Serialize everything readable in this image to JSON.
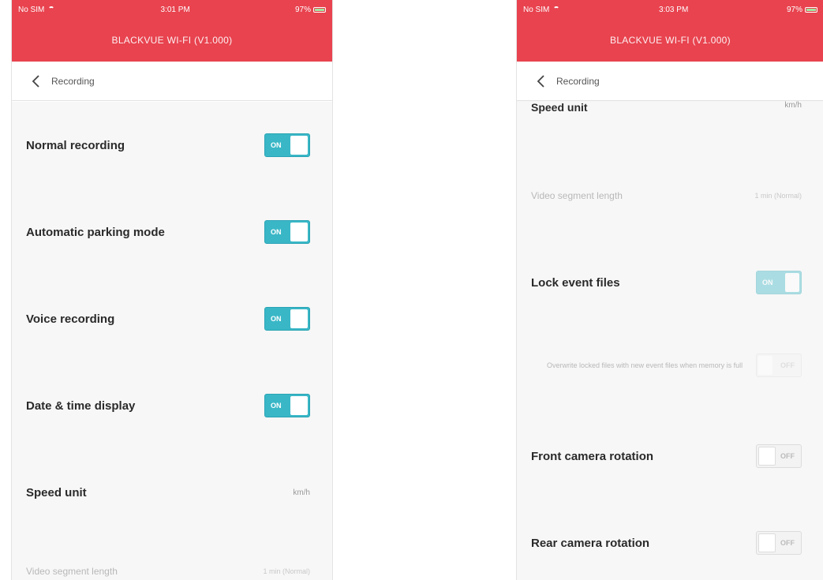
{
  "left": {
    "status": {
      "carrier": "No SIM",
      "time": "3:01 PM",
      "battery": "97%"
    },
    "app_title": "BLACKVUE WI-FI (V1.000)",
    "nav": {
      "title": "Recording"
    },
    "rows": [
      {
        "label": "Normal recording",
        "toggle": "ON"
      },
      {
        "label": "Automatic parking mode",
        "toggle": "ON"
      },
      {
        "label": "Voice recording",
        "toggle": "ON"
      },
      {
        "label": "Date & time display",
        "toggle": "ON"
      },
      {
        "label": "Speed unit",
        "value": "km/h"
      },
      {
        "label": "Video segment length",
        "value": "1 min (Normal)"
      }
    ]
  },
  "right": {
    "status": {
      "carrier": "No SIM",
      "time": "3:03 PM",
      "battery": "97%"
    },
    "app_title": "BLACKVUE WI-FI (V1.000)",
    "nav": {
      "title": "Recording"
    },
    "rows": [
      {
        "label": "Speed unit",
        "value": "km/h"
      },
      {
        "label": "Video segment length",
        "value": "1 min (Normal)"
      },
      {
        "label": "Lock event files",
        "toggle": "ON"
      },
      {
        "label": "Overwrite locked files with new event files when memory is full",
        "toggle": "OFF"
      },
      {
        "label": "Front camera rotation",
        "toggle": "OFF"
      },
      {
        "label": "Rear camera rotation",
        "toggle": "OFF"
      }
    ]
  },
  "colors": {
    "header": "#e8434f",
    "toggle_on": "#39b7c7",
    "background": "#f7f7f7"
  }
}
